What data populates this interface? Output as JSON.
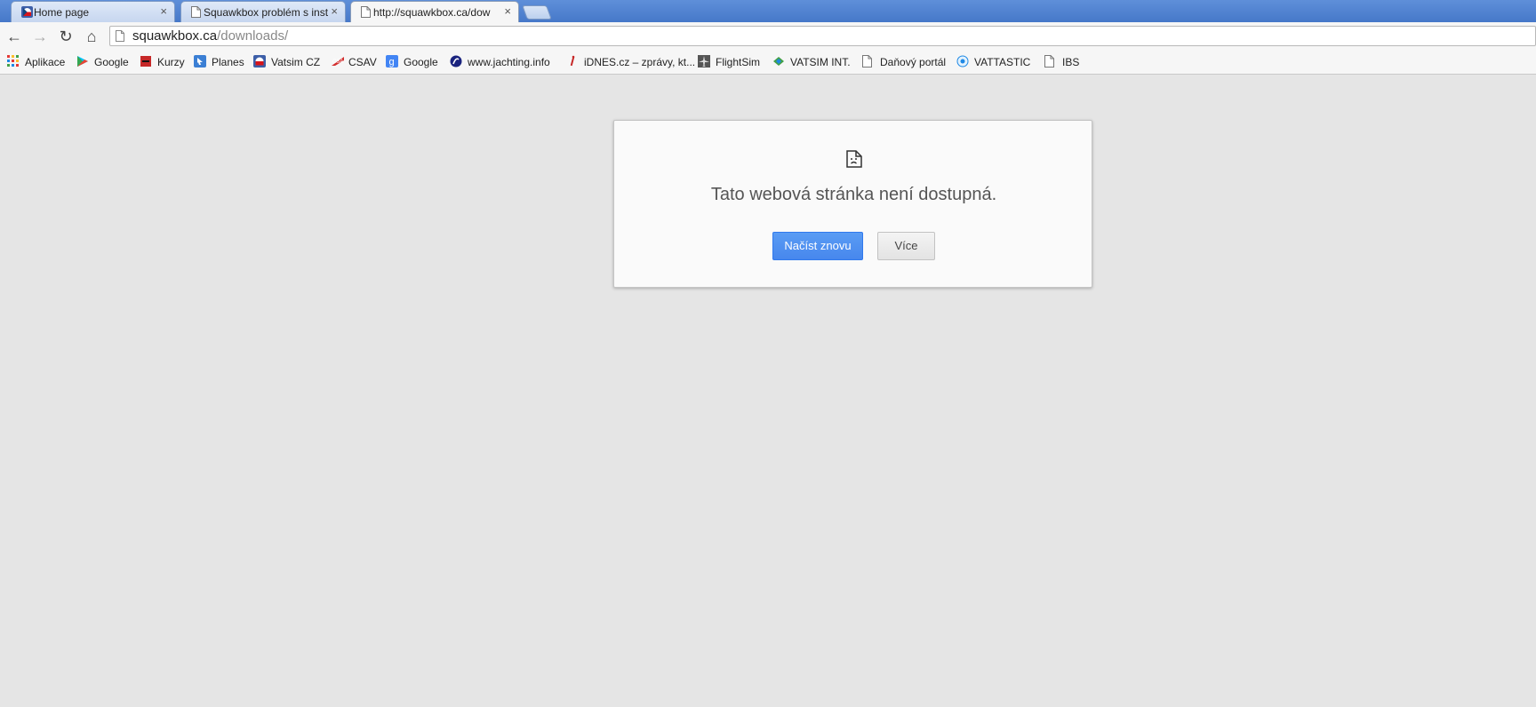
{
  "tabs": [
    {
      "title": "Home page",
      "icon": "flag-czech-icon",
      "close": "×"
    },
    {
      "title": "Squawkbox problém s inst",
      "icon": "page-icon",
      "close": "×"
    },
    {
      "title": "http://squawkbox.ca/dow",
      "icon": "page-icon",
      "close": "×",
      "active": true
    }
  ],
  "toolbar": {
    "back": "←",
    "forward": "→",
    "reload": "↻",
    "home": "⌂",
    "url_host": "squawkbox.ca",
    "url_path": "/downloads/"
  },
  "bookmarks": [
    {
      "label": "Aplikace",
      "icon": "apps-grid-icon"
    },
    {
      "label": "Google",
      "icon": "google-play-icon"
    },
    {
      "label": "Kurzy",
      "icon": "kurzy-icon"
    },
    {
      "label": "Planes",
      "icon": "planes-icon"
    },
    {
      "label": "Vatsim CZ",
      "icon": "vatsim-cz-icon"
    },
    {
      "label": "CSAV",
      "icon": "csa-icon"
    },
    {
      "label": "Google",
      "icon": "google-plus-icon"
    },
    {
      "label": "www.jachting.info",
      "icon": "jachting-icon"
    },
    {
      "label": "iDNES.cz – zprávy, kt...",
      "icon": "idnes-icon"
    },
    {
      "label": "FlightSim",
      "icon": "airplane-icon"
    },
    {
      "label": "VATSIM INT.",
      "icon": "vatsim-int-icon"
    },
    {
      "label": "Daňový portál",
      "icon": "page-icon"
    },
    {
      "label": "VATTASTIC",
      "icon": "vattastic-icon"
    },
    {
      "label": "IBS",
      "icon": "page-icon"
    }
  ],
  "error": {
    "message": "Tato webová stránka není dostupná.",
    "reload_label": "Načíst znovu",
    "more_label": "Více"
  },
  "colors": {
    "page_bg": "#e5e5e5",
    "reload_button": "#4d90fe"
  }
}
